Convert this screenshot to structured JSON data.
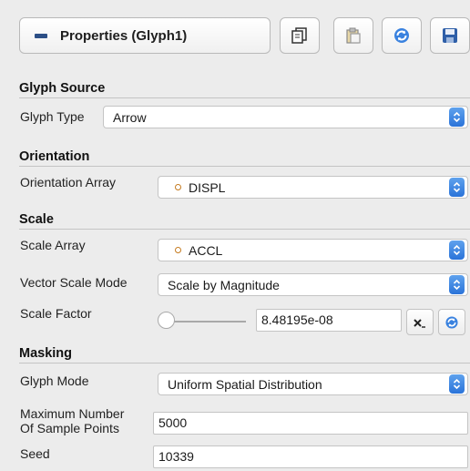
{
  "header": {
    "title": "Properties (Glyph1)",
    "buttons": [
      {
        "icon": "copy-icon"
      },
      {
        "icon": "paste-icon"
      },
      {
        "icon": "reload-icon"
      },
      {
        "icon": "save-icon"
      }
    ]
  },
  "glyph_source": {
    "section_label": "Glyph Source",
    "glyph_type_label": "Glyph Type",
    "glyph_type_value": "Arrow"
  },
  "orientation": {
    "section_label": "Orientation",
    "array_label": "Orientation Array",
    "array_value": "DISPL"
  },
  "scale": {
    "section_label": "Scale",
    "array_label": "Scale Array",
    "array_value": "ACCL",
    "mode_label": "Vector Scale Mode",
    "mode_value": "Scale by Magnitude",
    "factor_label": "Scale Factor",
    "factor_value": "8.48195e-08",
    "factor_slider_fraction": 0.0
  },
  "masking": {
    "section_label": "Masking",
    "mode_label": "Glyph Mode",
    "mode_value": "Uniform Spatial Distribution",
    "max_points_label_line1": "Maximum Number",
    "max_points_label_line2": "Of Sample Points",
    "max_points_value": "5000",
    "seed_label": "Seed",
    "seed_value": "10339"
  },
  "colors": {
    "accent": "#2a73d9",
    "array_dot": "#c57a1f",
    "panel_bg": "#ececec"
  }
}
